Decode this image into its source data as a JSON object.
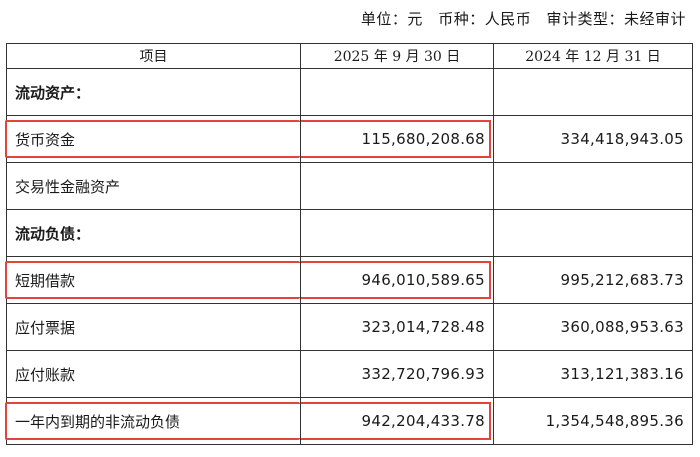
{
  "meta": {
    "unit": "单位：元",
    "currency": "币种：人民币",
    "audit": "审计类型：未经审计"
  },
  "table": {
    "headers": [
      "项目",
      "2025 年 9 月 30 日",
      "2024 年 12 月 31 日"
    ],
    "rows": [
      {
        "label": "流动资产：",
        "a": "",
        "b": "",
        "section": true
      },
      {
        "label": "货币资金",
        "a": "115,680,208.68",
        "b": "334,418,943.05",
        "highlight": true
      },
      {
        "label": "交易性金融资产",
        "a": "",
        "b": ""
      },
      {
        "label": "流动负债：",
        "a": "",
        "b": "",
        "section": true
      },
      {
        "label": "短期借款",
        "a": "946,010,589.65",
        "b": "995,212,683.73",
        "highlight": true
      },
      {
        "label": "应付票据",
        "a": "323,014,728.48",
        "b": "360,088,953.63"
      },
      {
        "label": "应付账款",
        "a": "332,720,796.93",
        "b": "313,121,383.16"
      },
      {
        "label": "一年内到期的非流动负债",
        "a": "942,204,433.78",
        "b": "1,354,548,895.36",
        "highlight": true
      }
    ]
  },
  "colors": {
    "highlight": "#e0443a",
    "border": "#333333"
  }
}
